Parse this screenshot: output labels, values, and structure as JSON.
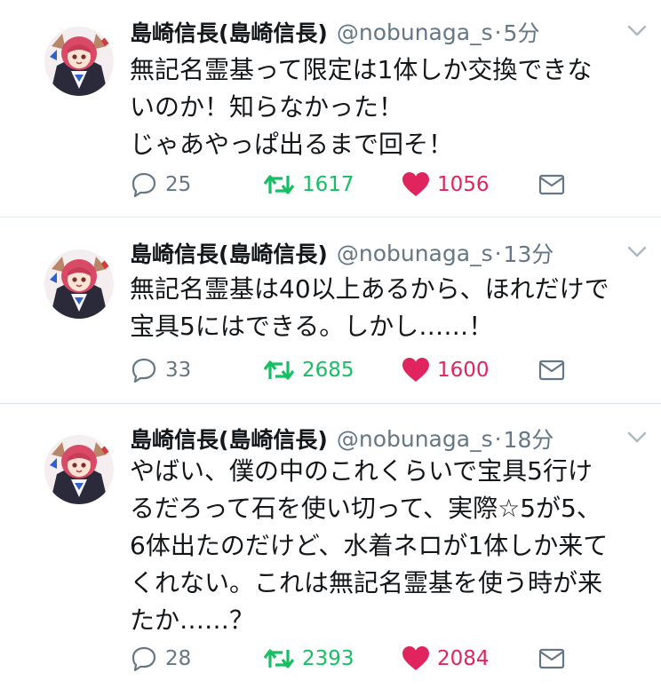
{
  "colors": {
    "text": "#14171a",
    "muted": "#657786",
    "retweet": "#17bf63",
    "like": "#e0245e",
    "divider": "#e1e8ed"
  },
  "tweets": [
    {
      "display_name": "島崎信長(島崎信長)",
      "handle": "@nobunaga_s",
      "dot": "·",
      "time": "5分",
      "lines": [
        "無記名霊基って限定は1体しか交換できな",
        "いのか！知らなかった！",
        "じゃあやっぱ出るまで回そ！"
      ],
      "replies": "25",
      "retweets": "1617",
      "likes": "1056"
    },
    {
      "display_name": "島崎信長(島崎信長)",
      "handle": "@nobunaga_s",
      "dot": "·",
      "time": "13分",
      "lines": [
        "無記名霊基は40以上あるから、ほれだけで",
        "宝具5にはできる。しかし……！"
      ],
      "replies": "33",
      "retweets": "2685",
      "likes": "1600"
    },
    {
      "display_name": "島崎信長(島崎信長)",
      "handle": "@nobunaga_s",
      "dot": "·",
      "time": "18分",
      "lines": [
        "やばい、僕の中のこれくらいで宝具5行け",
        "るだろって石を使い切って、実際☆5が5、",
        "6体出たのだけど、水着ネロが1体しか来て",
        "くれない。これは無記名霊基を使う時が来",
        "たか……？"
      ],
      "replies": "28",
      "retweets": "2393",
      "likes": "2084"
    }
  ],
  "icons": {
    "avatar": "avatar-icon",
    "caret": "chevron-down-icon",
    "reply": "reply-icon",
    "retweet": "retweet-icon",
    "like": "heart-icon",
    "dm": "envelope-icon"
  }
}
